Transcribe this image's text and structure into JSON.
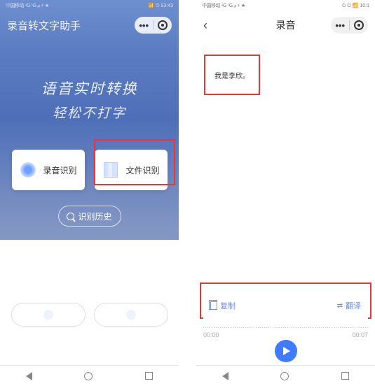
{
  "status": {
    "carrier_left": "中国移动 ⁴G ⁵G ₐₗₗ ⚡︎ ★",
    "batt_right_1": "📶 ⏻ 93:43",
    "batt_right_2": "⏱ ⏻ 📶 10:1"
  },
  "p1": {
    "app_title": "录音转文字助手",
    "hero_line1": "语音实时转换",
    "hero_line2": "轻松不打字",
    "card_audio": "录音识别",
    "card_file": "文件识别",
    "history": "识别历史"
  },
  "p2": {
    "title": "录音",
    "result_text": "我是李欣。",
    "copy": "复制",
    "translate": "翻译",
    "time_start": "00:00",
    "time_end": "00:07"
  }
}
